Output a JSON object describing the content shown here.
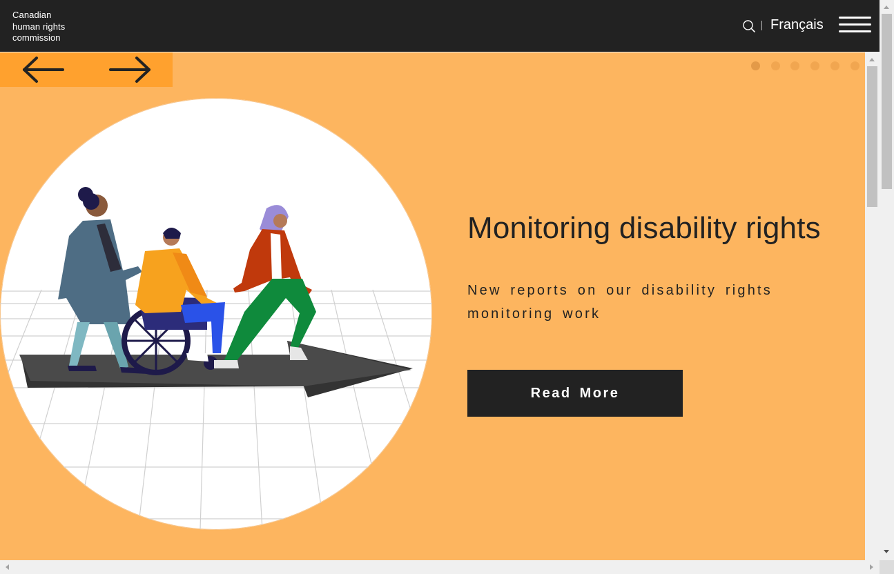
{
  "header": {
    "logo_lines": [
      "Canadian",
      "human rights",
      "commission"
    ],
    "language_link": "Français",
    "search_icon": "search-icon",
    "menu_icon": "hamburger-menu-icon"
  },
  "slider": {
    "prev_icon": "arrow-left-icon",
    "next_icon": "arrow-right-icon",
    "dot_count": 6,
    "active_dot": 1,
    "title": "Monitoring disability rights",
    "text": "New reports on our disability rights monitoring work",
    "button_label": "Read More",
    "illustration": "people-walking-on-arrow-illustration"
  },
  "colors": {
    "header_bg": "#222222",
    "slide_bg": "#fdb55f",
    "nav_bg": "#ffa12e",
    "button_bg": "#222222"
  }
}
